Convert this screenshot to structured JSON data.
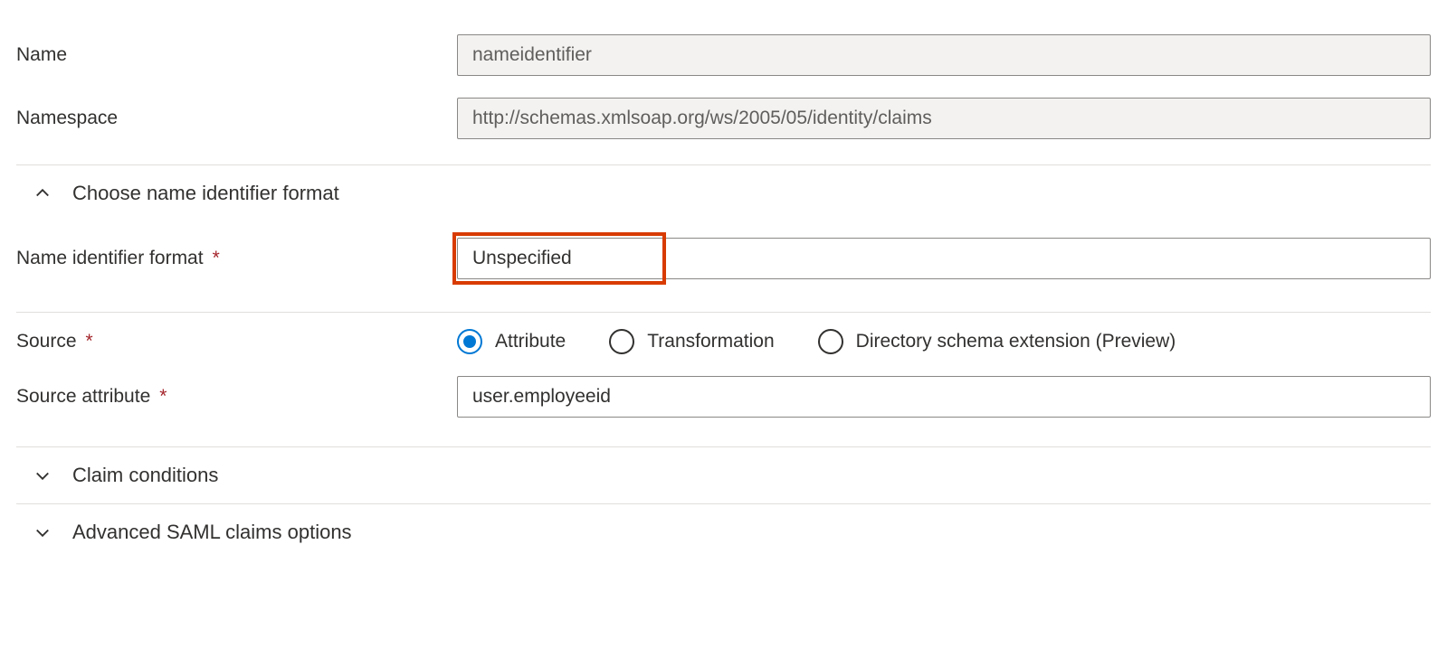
{
  "fields": {
    "name": {
      "label": "Name",
      "value": "nameidentifier"
    },
    "namespace": {
      "label": "Namespace",
      "value": "http://schemas.xmlsoap.org/ws/2005/05/identity/claims"
    },
    "name_identifier_format": {
      "label": "Name identifier format",
      "value": "Unspecified"
    },
    "source": {
      "label": "Source",
      "options": [
        {
          "label": "Attribute",
          "selected": true
        },
        {
          "label": "Transformation",
          "selected": false
        },
        {
          "label": "Directory schema extension (Preview)",
          "selected": false
        }
      ]
    },
    "source_attribute": {
      "label": "Source attribute",
      "value": "user.employeeid"
    }
  },
  "sections": {
    "choose_format": {
      "title": "Choose name identifier format",
      "expanded": true
    },
    "claim_conditions": {
      "title": "Claim conditions",
      "expanded": false
    },
    "advanced_saml": {
      "title": "Advanced SAML claims options",
      "expanded": false
    }
  },
  "required_marker": "*"
}
